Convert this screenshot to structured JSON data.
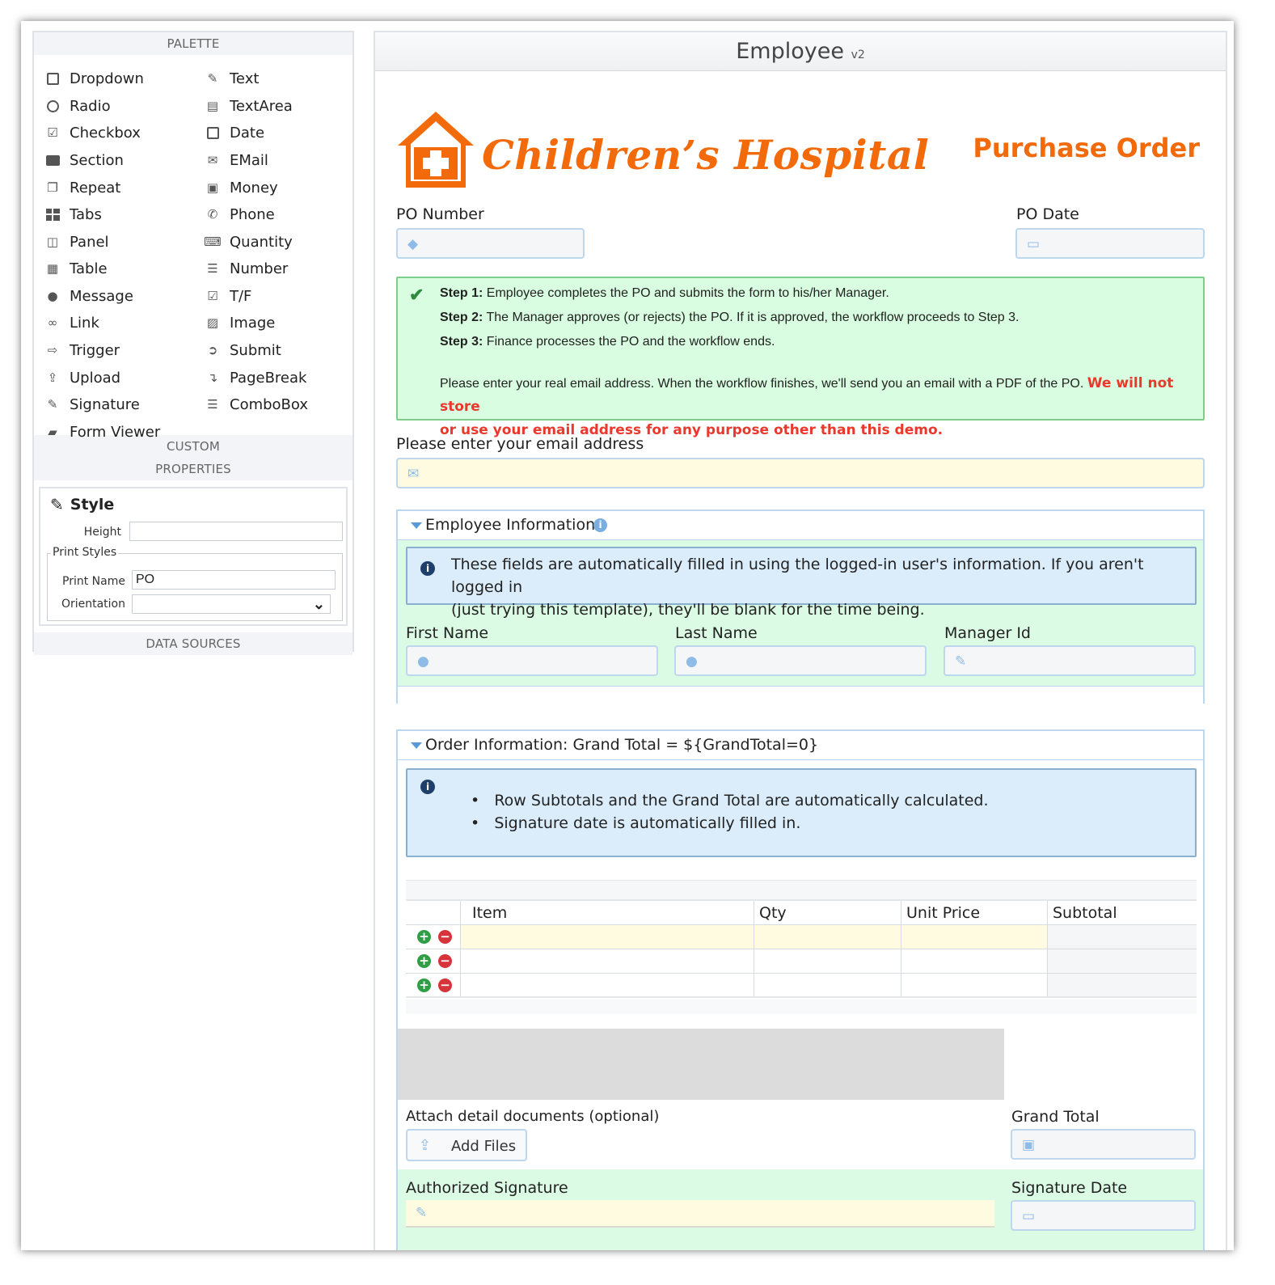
{
  "palette": {
    "header": "PALETTE",
    "left_items": [
      {
        "label": "Dropdown",
        "icon": "dropdown-icon"
      },
      {
        "label": "Radio",
        "icon": "radio-icon"
      },
      {
        "label": "Checkbox",
        "icon": "checkbox-icon"
      },
      {
        "label": "Section",
        "icon": "folder-icon"
      },
      {
        "label": "Repeat",
        "icon": "copy-icon"
      },
      {
        "label": "Tabs",
        "icon": "tabs-icon"
      },
      {
        "label": "Panel",
        "icon": "panel-icon"
      },
      {
        "label": "Table",
        "icon": "table-icon"
      },
      {
        "label": "Message",
        "icon": "comment-icon"
      },
      {
        "label": "Link",
        "icon": "link-icon"
      },
      {
        "label": "Trigger",
        "icon": "trigger-icon"
      },
      {
        "label": "Upload",
        "icon": "upload-icon"
      },
      {
        "label": "Signature",
        "icon": "pencil-icon"
      },
      {
        "label": "Form Viewer",
        "icon": "book-icon"
      }
    ],
    "right_items": [
      {
        "label": "Text",
        "icon": "edit-icon"
      },
      {
        "label": "TextArea",
        "icon": "textarea-icon"
      },
      {
        "label": "Date",
        "icon": "calendar-icon"
      },
      {
        "label": "EMail",
        "icon": "envelope-icon"
      },
      {
        "label": "Money",
        "icon": "money-icon"
      },
      {
        "label": "Phone",
        "icon": "phone-icon"
      },
      {
        "label": "Quantity",
        "icon": "keyboard-icon"
      },
      {
        "label": "Number",
        "icon": "list-numbered-icon"
      },
      {
        "label": "T/F",
        "icon": "check-square-icon"
      },
      {
        "label": "Image",
        "icon": "image-icon"
      },
      {
        "label": "Submit",
        "icon": "sign-in-icon"
      },
      {
        "label": "PageBreak",
        "icon": "level-down-icon"
      },
      {
        "label": "ComboBox",
        "icon": "list-icon"
      }
    ]
  },
  "custom_header": "CUSTOM",
  "properties": {
    "header": "PROPERTIES",
    "style_title": "Style",
    "height_label": "Height",
    "height_value": "",
    "print_styles_legend": "Print Styles",
    "print_name_label": "Print Name",
    "print_name_value": "PO",
    "orientation_label": "Orientation",
    "orientation_value": ""
  },
  "data_sources_header": "DATA SOURCES",
  "form": {
    "title": "Employee",
    "version": "v2",
    "logo_text": "Children’s Hospital",
    "po_title": "Purchase Order",
    "po_number_label": "PO Number",
    "po_date_label": "PO Date",
    "steps": [
      {
        "label": "Step 1:",
        "text": " Employee completes the PO and submits the form to his/her Manager."
      },
      {
        "label": "Step 2:",
        "text": " The Manager approves (or rejects) the PO. If it is approved, the workflow proceeds to Step 3."
      },
      {
        "label": "Step 3:",
        "text": " Finance processes the PO and the workflow ends."
      }
    ],
    "email_notice": "Please enter your real email address. When the workflow finishes, we'll send you an email with a PDF of the PO. ",
    "email_warning_1": "We will not store",
    "email_warning_2": "or use your email address for any purpose other than this demo.",
    "email_label": "Please enter your email address",
    "employee_panel": {
      "title": "Employee Information",
      "info_line_1": "These fields are automatically filled in using the logged-in user's information. If you aren't logged in",
      "info_line_2": "(just trying this template), they'll be blank for the time being.",
      "first_name_label": "First Name",
      "last_name_label": "Last Name",
      "manager_id_label": "Manager Id"
    },
    "order_panel": {
      "title": "Order Information: Grand Total = ${GrandTotal=0}",
      "bullets": [
        "Row Subtotals and the Grand Total are automatically calculated.",
        "Signature date is automatically filled in."
      ],
      "columns": [
        "Item",
        "Qty",
        "Unit Price",
        "Subtotal"
      ],
      "row_count": 3,
      "attach_label": "Attach detail documents (optional)",
      "add_files_label": "Add Files",
      "grand_total_label": "Grand Total",
      "authorized_signature_label": "Authorized Signature",
      "signature_date_label": "Signature Date"
    }
  },
  "colors": {
    "accent_orange": "#f26a0a",
    "success_green": "#2e8b3e",
    "warning_red": "#e8392c",
    "field_border": "#bcd7ee"
  }
}
